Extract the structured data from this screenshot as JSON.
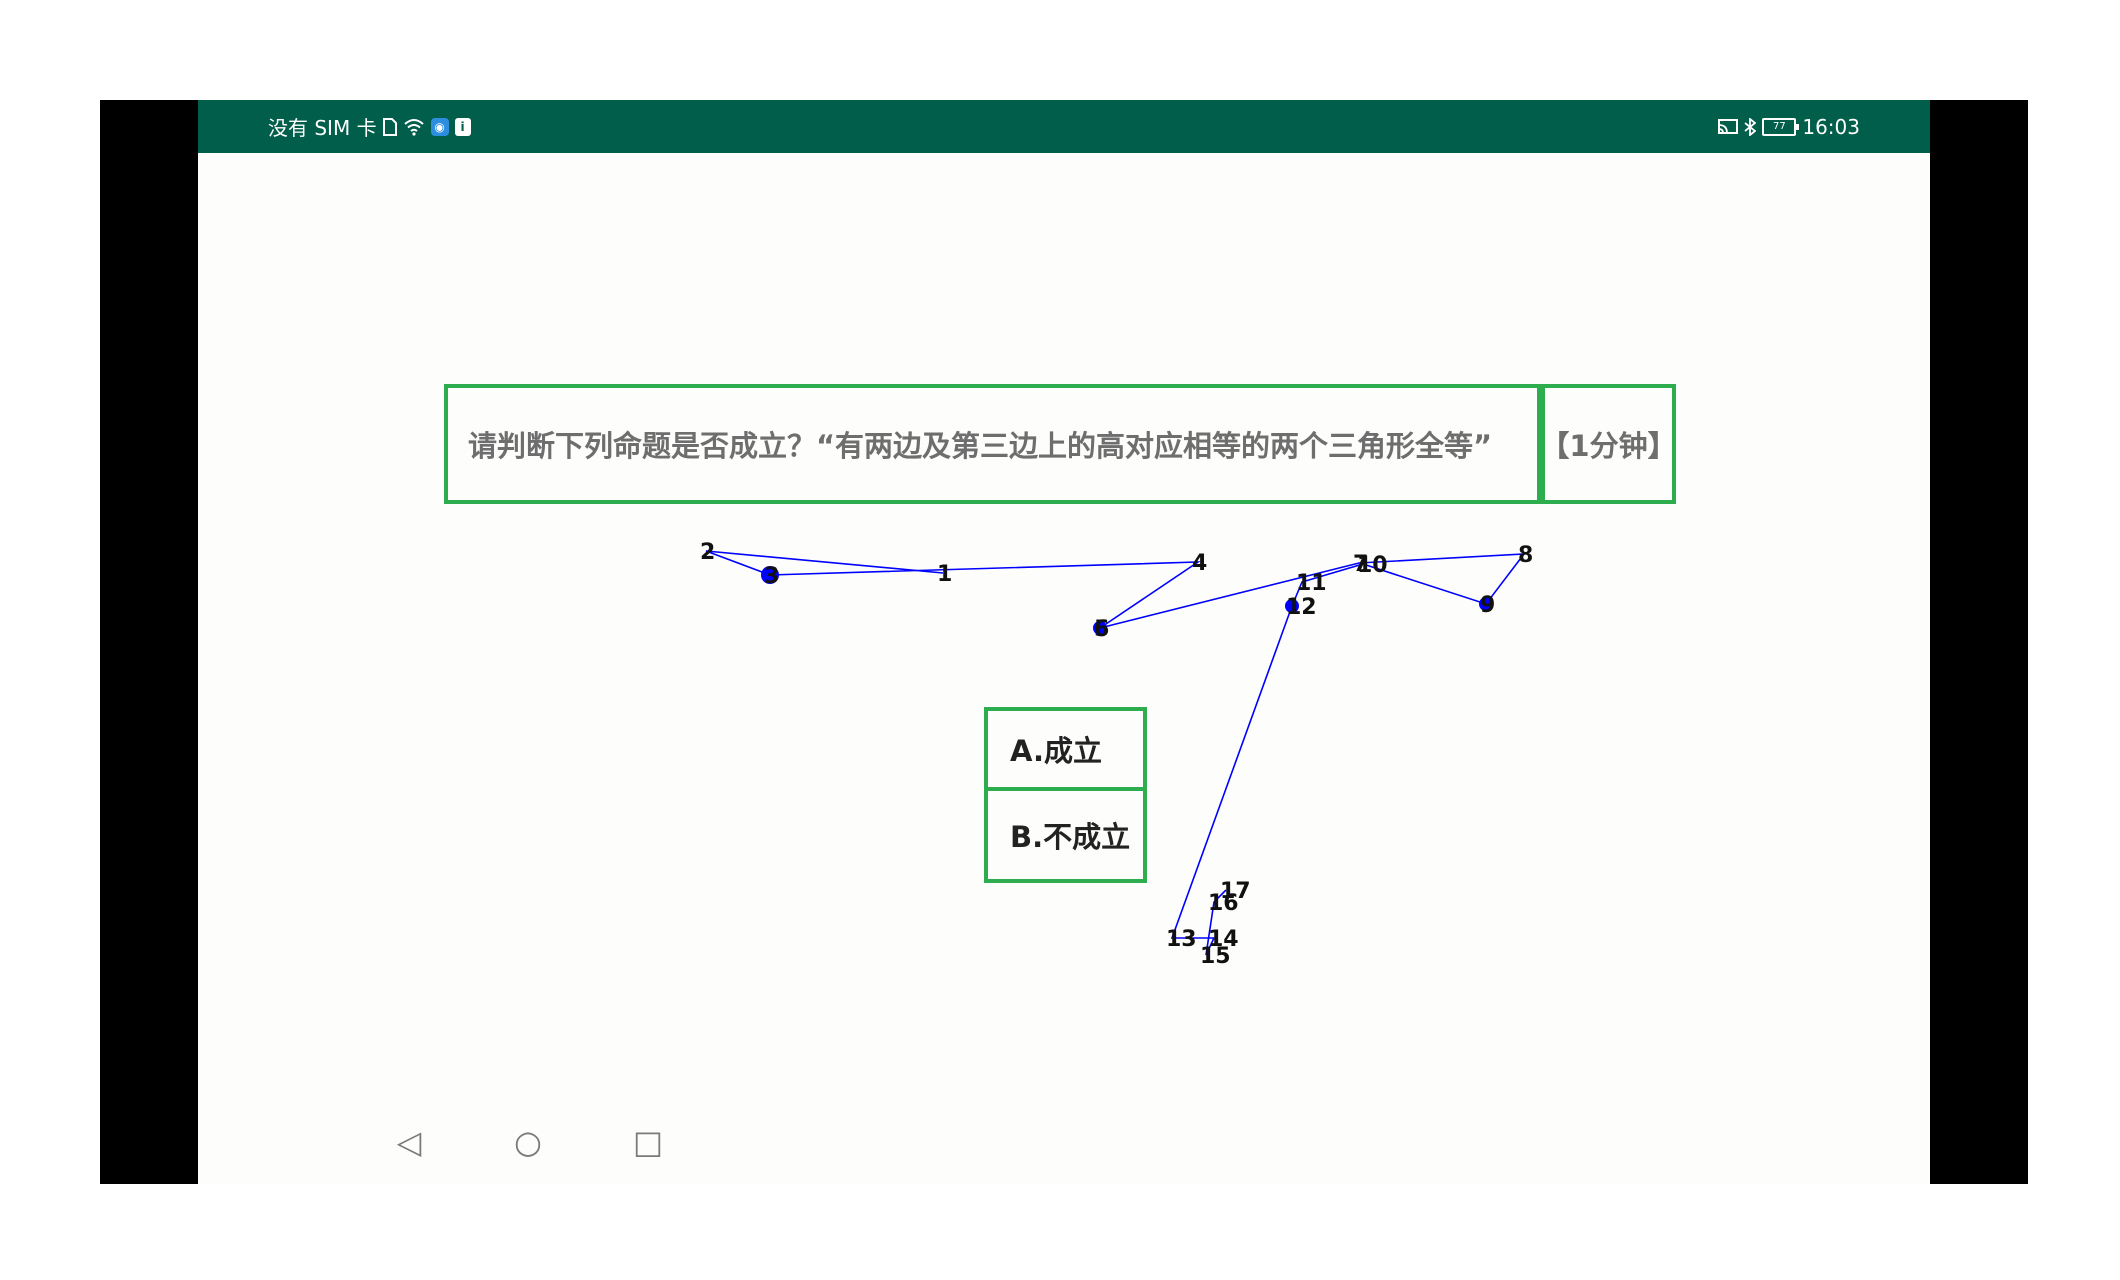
{
  "status_bar": {
    "carrier": "没有 SIM 卡",
    "time": "16:03",
    "battery_level": "77",
    "icons_left": [
      "sim-card-icon",
      "wifi-icon",
      "app-notification-icon",
      "info-notification-icon"
    ],
    "icons_right": [
      "cast-icon",
      "bluetooth-icon",
      "battery-icon"
    ]
  },
  "quiz": {
    "question": "请判断下列命题是否成立？“有两边及第三边上的高对应相等的两个三角形全等”",
    "time_limit": "【1分钟】",
    "options": [
      {
        "label": "A.成立"
      },
      {
        "label": "B.不成立"
      }
    ]
  },
  "touch_trace": {
    "color": "#0000ff",
    "points": [
      {
        "n": "1"
      },
      {
        "n": "2"
      },
      {
        "n": "3"
      },
      {
        "n": "4"
      },
      {
        "n": "5"
      },
      {
        "n": "6"
      },
      {
        "n": "7"
      },
      {
        "n": "8"
      },
      {
        "n": "9"
      },
      {
        "n": "10"
      },
      {
        "n": "11"
      },
      {
        "n": "12"
      },
      {
        "n": "13"
      },
      {
        "n": "14"
      },
      {
        "n": "15"
      },
      {
        "n": "16"
      },
      {
        "n": "17"
      }
    ]
  },
  "nav_bar": {
    "back_glyph": "◁",
    "home_glyph": "○",
    "recents_glyph": "□"
  },
  "colors": {
    "status_bar": "#005e4a",
    "box_border": "#2ead4e",
    "question_text": "#6e6e6e",
    "option_text": "#222222"
  }
}
